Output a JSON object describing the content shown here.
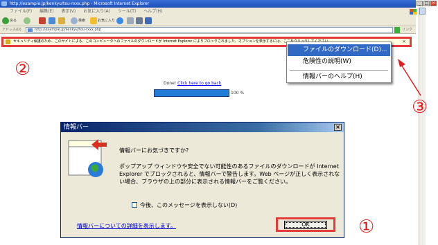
{
  "browser": {
    "title": "http://example.jp/kenkyu/tou-rxxx.php - Microsoft Internet Explorer",
    "menu": [
      "ファイル(F)",
      "編集(E)",
      "表示(V)",
      "お気に入り(A)",
      "ツール(T)",
      "ヘルプ(H)"
    ],
    "toolbar": {
      "back": "戻る",
      "search": "検索",
      "favorites": "お気に入り"
    },
    "address_label": "アドレス(D)",
    "address_value": "http://example.jp/kenkyu/tou-rxxx.php",
    "links_label": "リンク"
  },
  "infobar": {
    "text": "セキュリティ保護のため、このサイトによる、このコンピュータへのファイルのダウンロードが Internet Explorer によりブロックされました。オプションを表示するには、ここをクリックしてください..."
  },
  "context_menu": {
    "items": [
      "ファイルのダウンロード(D)...",
      "危険性の説明(W)",
      "情報バーのヘルプ(H)"
    ]
  },
  "page": {
    "done_prefix": "Done!",
    "done_link": "Click here to go back",
    "progress_percent": 100,
    "progress_label": "100 %"
  },
  "dialog": {
    "title": "情報バー",
    "close": "×",
    "heading": "情報バーにお気づきですか?",
    "body": "ポップアップ ウィンドウや安全でない可能性のあるファイルのダウンロードが Internet Explorer でブロックされると、情報バーで警告します。Web ページが正しく表示されない場合、ブラウザの上の部分に表示される情報バーをご覧ください。",
    "checkbox_label": "今後、このメッセージを表示しない(D)",
    "link": "情報バーについての詳細を表示します。",
    "ok": "OK"
  },
  "markers": {
    "one": "①",
    "two": "②",
    "three": "③"
  },
  "colors": {
    "highlight": "#e53a3a",
    "selection": "#316ac5",
    "progress": "#1f7dd8"
  }
}
